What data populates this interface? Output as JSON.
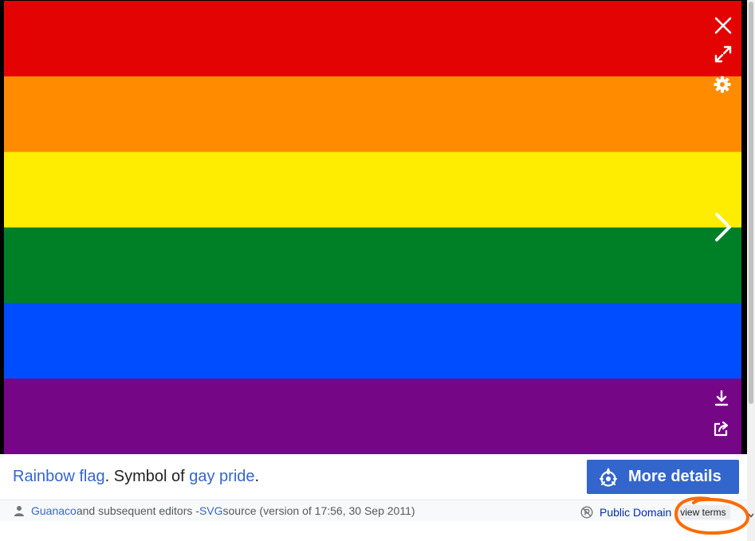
{
  "flag": {
    "stripes": [
      {
        "name": "red",
        "color": "#e40303"
      },
      {
        "name": "orange",
        "color": "#ff8c00"
      },
      {
        "name": "yellow",
        "color": "#ffed00"
      },
      {
        "name": "green",
        "color": "#008026"
      },
      {
        "name": "blue",
        "color": "#004dff"
      },
      {
        "name": "violet",
        "color": "#750787"
      }
    ]
  },
  "controls": {
    "top": [
      "close-icon",
      "fullscreen-icon",
      "settings-gear-icon"
    ],
    "next": "chevron-right-icon",
    "bottom": [
      "download-icon",
      "share-icon"
    ]
  },
  "caption": {
    "link1": "Rainbow flag",
    "text1": ". Symbol of ",
    "link2": "gay pride",
    "text2": "."
  },
  "more_details": {
    "label": "More details",
    "icon": "wikimedia-commons-icon",
    "color": "#3366cc"
  },
  "credit": {
    "author": "Guanaco",
    "text1": " and subsequent editors - ",
    "source_link": "SVG",
    "text2": " source (version of 17:56, 30 Sep 2011)"
  },
  "license": {
    "icon": "public-domain-icon",
    "label": "Public Domain",
    "view_terms": "view terms"
  },
  "annotation": {
    "shape": "hand-drawn-circle",
    "color": "#ff6a00"
  }
}
